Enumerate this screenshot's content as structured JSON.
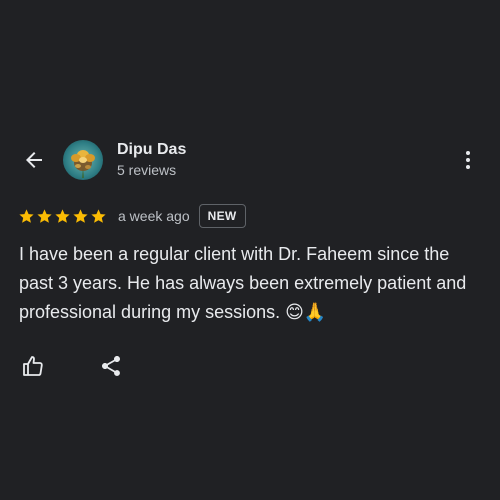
{
  "header": {
    "back_icon": "arrow-back-icon",
    "user_name": "Dipu Das",
    "reviews_count": "5 reviews",
    "avatar_icon": "avatar-flower-image",
    "more_icon": "more-vert-icon"
  },
  "rating": {
    "stars": 5,
    "max_stars": 5,
    "star_color": "#fbbc04",
    "time": "a week ago",
    "badge": "NEW"
  },
  "review": {
    "text": "I have been a regular client with Dr. Faheem since the past 3 years. He has always been extremely patient and professional during my sessions. 😊🙏"
  },
  "actions": {
    "like_icon": "thumb-up-icon",
    "share_icon": "share-icon"
  },
  "colors": {
    "background": "#202124",
    "text_primary": "#e8eaed",
    "text_secondary": "#bdc1c6",
    "border": "#5f6368"
  }
}
